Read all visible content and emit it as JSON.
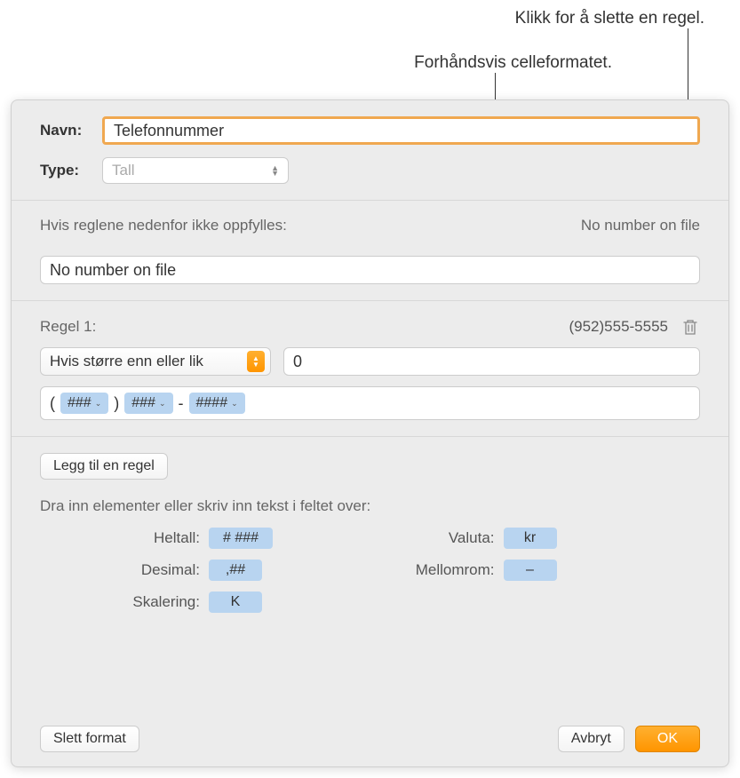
{
  "callouts": {
    "deleteRule": "Klikk for å slette en regel.",
    "previewFormat": "Forhåndsvis celleformatet."
  },
  "fields": {
    "nameLabel": "Navn:",
    "nameValue": "Telefonnummer",
    "typeLabel": "Type:",
    "typeValue": "Tall"
  },
  "fallback": {
    "heading": "Hvis reglene nedenfor ikke oppfylles:",
    "preview": "No number on file",
    "value": "No number on file"
  },
  "rule": {
    "title": "Regel 1:",
    "preview": "(952)555-5555",
    "condition": "Hvis større enn eller lik",
    "compareValue": "0",
    "tokens": {
      "open": "(",
      "t1": "###",
      "close": ")",
      "t2": "###",
      "sep": "-",
      "t3": "####"
    }
  },
  "actions": {
    "addRule": "Legg til en regel",
    "dragHint": "Dra inn elementer eller skriv inn tekst i feltet over:"
  },
  "dragTokens": {
    "integerLabel": "Heltall:",
    "integerToken": "# ###",
    "decimalLabel": "Desimal:",
    "decimalToken": ",##",
    "scaleLabel": "Skalering:",
    "scaleToken": "K",
    "currencyLabel": "Valuta:",
    "currencyToken": "kr",
    "spaceLabel": "Mellomrom:",
    "spaceToken": "–"
  },
  "footer": {
    "delete": "Slett format",
    "cancel": "Avbryt",
    "ok": "OK"
  }
}
